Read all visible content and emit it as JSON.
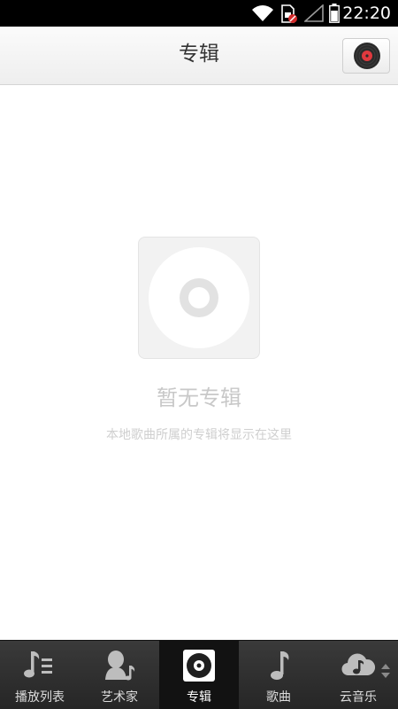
{
  "status_bar": {
    "time": "22:20",
    "icons": [
      "wifi-icon",
      "sim-card-blocked-icon",
      "cell-signal-empty-icon",
      "battery-icon"
    ]
  },
  "header": {
    "title": "专辑",
    "now_playing_icon": "vinyl-record-icon"
  },
  "empty_state": {
    "icon": "cd-disc-icon",
    "title": "暂无专辑",
    "description": "本地歌曲所属的专辑将显示在这里"
  },
  "tabs": [
    {
      "label": "播放列表",
      "icon": "playlist-icon",
      "active": false
    },
    {
      "label": "艺术家",
      "icon": "artist-icon",
      "active": false
    },
    {
      "label": "专辑",
      "icon": "album-icon",
      "active": true
    },
    {
      "label": "歌曲",
      "icon": "music-note-icon",
      "active": false
    },
    {
      "label": "云音乐",
      "icon": "cloud-music-icon",
      "active": false
    }
  ],
  "colors": {
    "accent_record": "#e0393e",
    "tab_bar": "#2e2e2e",
    "active_tab": "#121212"
  }
}
